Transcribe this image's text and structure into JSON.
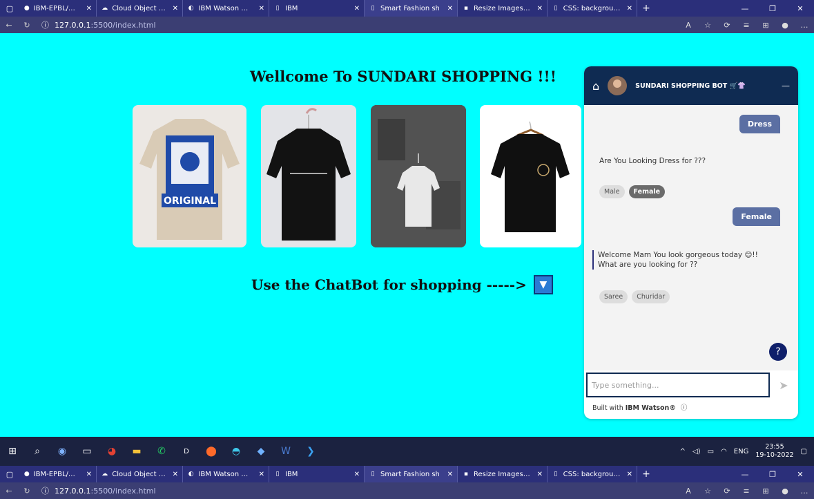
{
  "browser_top": {
    "tabs": [
      {
        "label": "IBM-EPBL/Assign",
        "icon": "github-icon"
      },
      {
        "label": "Cloud Object Sto",
        "icon": "cloud-icon"
      },
      {
        "label": "IBM Watson Assi",
        "icon": "watson-icon"
      },
      {
        "label": "IBM",
        "icon": "page-icon"
      },
      {
        "label": "Smart Fashion sh",
        "icon": "page-icon"
      },
      {
        "label": "Resize Images O",
        "icon": "resize-icon"
      },
      {
        "label": "CSS: background",
        "icon": "page-icon"
      }
    ],
    "url_host": "127.0.0.1",
    "url_rest": ":5500/index.html"
  },
  "page": {
    "heading": "Wellcome To SUNDARI SHOPPING !!!",
    "subheading": "Use the ChatBot for shopping ----->",
    "subheading_icon": "▼",
    "products": [
      {
        "name": "beige-original-tshirt",
        "bg": "#ece8e4"
      },
      {
        "name": "black-hanging-tshirt",
        "bg": "#e3e4e8"
      },
      {
        "name": "white-tshirt-on-wall",
        "bg": "#4a4a4a"
      },
      {
        "name": "black-logo-tshirt",
        "bg": "#ffffff"
      }
    ],
    "product_tshirt_text": "ORIGINAL"
  },
  "chatbot": {
    "title": "SUNDARI SHOPPING BOT 🛒👚",
    "minimize": "—",
    "messages": {
      "user1": "Dress",
      "bot1": "Are You Looking Dress for ???",
      "options1": [
        "Male",
        "Female"
      ],
      "user2": "Female",
      "bot2_line1": "Welcome Mam You look gorgeous today 😊!!",
      "bot2_line2": "What are you looking for ??",
      "options2": [
        "Saree",
        "Churidar"
      ]
    },
    "help": "?",
    "input_placeholder": "Type something...",
    "footer_prefix": "Built with ",
    "footer_brand": "IBM Watson®",
    "footer_info": "ⓘ"
  },
  "taskbar": {
    "tray_lang": "ENG",
    "time": "23:55",
    "date": "19-10-2022"
  },
  "colors": {
    "page_bg": "#00ffff",
    "chat_header": "#0f2b52",
    "user_bubble": "#5b6fa3",
    "help_button": "#0f1f6a"
  }
}
